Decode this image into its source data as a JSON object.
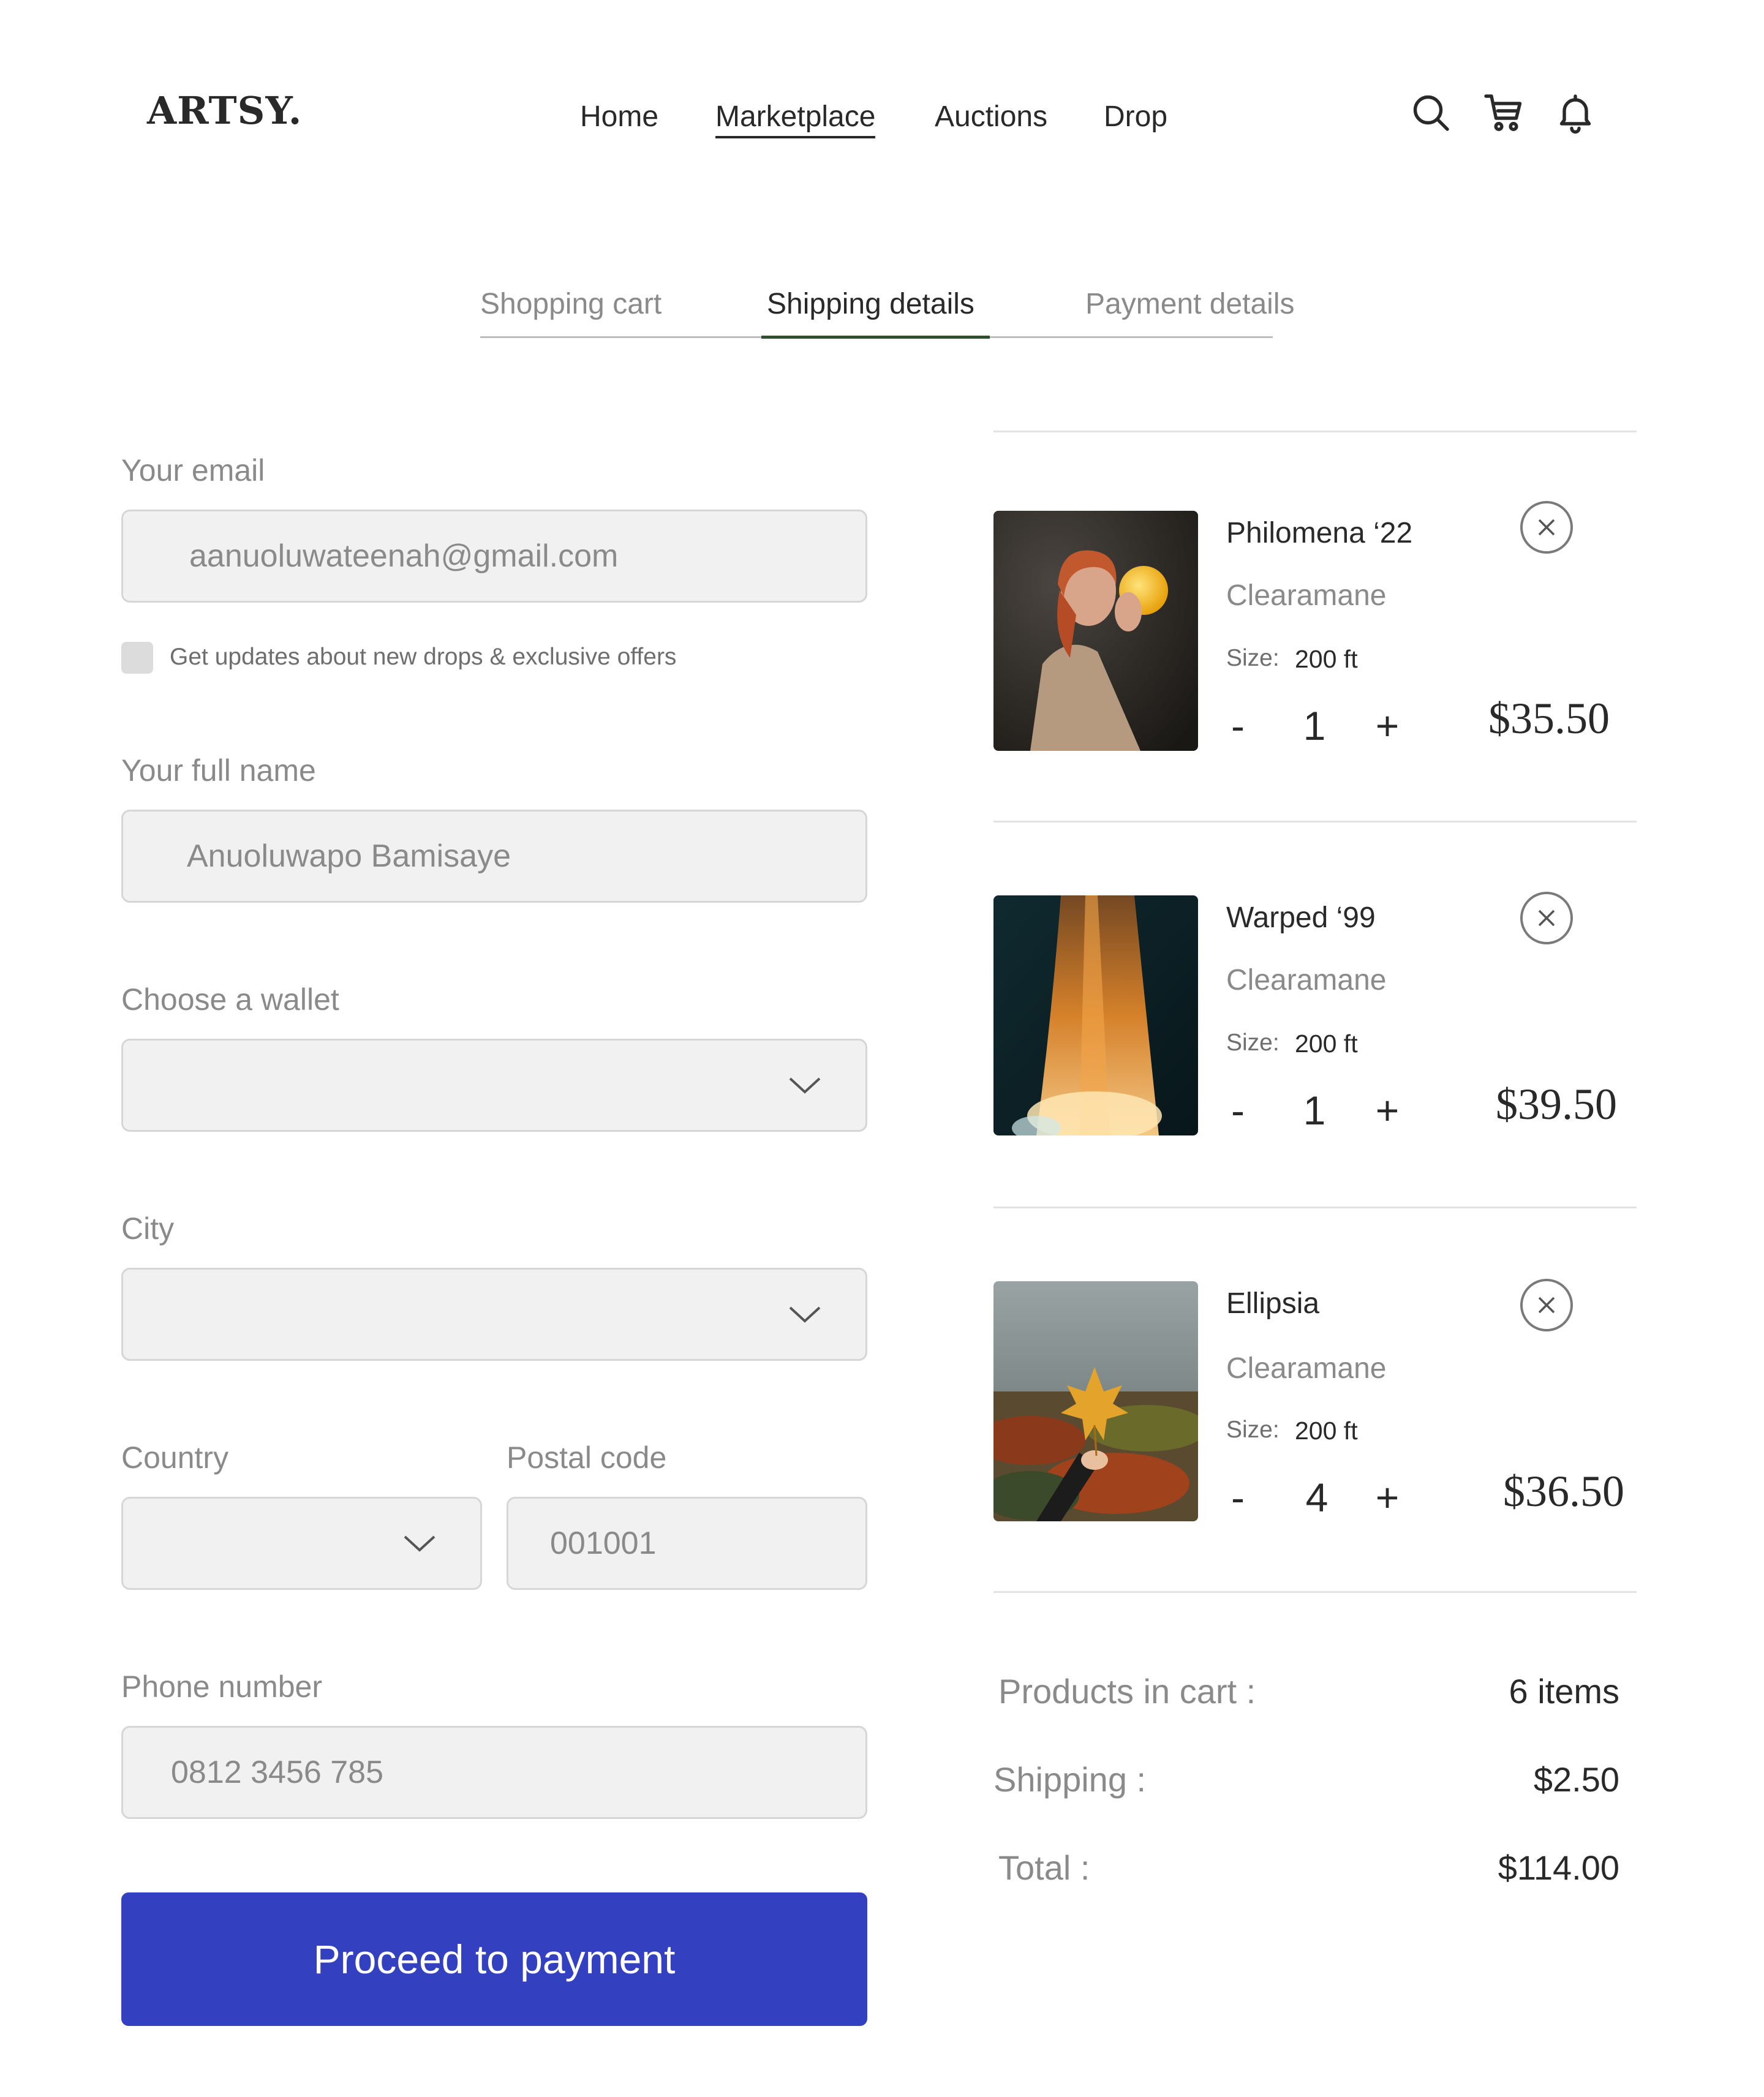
{
  "header": {
    "logo": "ARTSY.",
    "nav": [
      {
        "label": "Home",
        "active": false
      },
      {
        "label": "Marketplace",
        "active": true
      },
      {
        "label": "Auctions",
        "active": false
      },
      {
        "label": "Drop",
        "active": false
      }
    ],
    "icons": [
      "search-icon",
      "cart-icon",
      "bell-icon"
    ]
  },
  "steps": [
    {
      "label": "Shopping cart",
      "active": false
    },
    {
      "label": "Shipping details",
      "active": true
    },
    {
      "label": "Payment details",
      "active": false
    }
  ],
  "form": {
    "email": {
      "label": "Your email",
      "value": "aanuoluwateenah@gmail.com"
    },
    "updates_checkbox": {
      "label": "Get updates about new drops & exclusive offers",
      "checked": false
    },
    "full_name": {
      "label": "Your full name",
      "value": "Anuoluwapo Bamisaye"
    },
    "wallet": {
      "label": "Choose a wallet",
      "value": ""
    },
    "city": {
      "label": "City",
      "value": ""
    },
    "country": {
      "label": "Country",
      "value": ""
    },
    "postal_code": {
      "label": "Postal code",
      "value": "001001"
    },
    "phone": {
      "label": "Phone number",
      "value": "0812 3456 785"
    },
    "submit_label": "Proceed to payment"
  },
  "cart": {
    "size_label": "Size:",
    "decrement": "-",
    "increment": "+",
    "items": [
      {
        "name": "Philomena ‘22",
        "artist": "Clearamane",
        "size": "200 ft",
        "qty": "1",
        "price": "$35.50",
        "image": "woman-holding-glowing-orb"
      },
      {
        "name": "Warped ‘99",
        "artist": "Clearamane",
        "size": "200 ft",
        "qty": "1",
        "price": "$39.50",
        "image": "orange-fabric-flame"
      },
      {
        "name": "Ellipsia",
        "artist": "Clearamane",
        "size": "200 ft",
        "qty": "4",
        "price": "$36.50",
        "image": "hand-holding-maple-leaf"
      }
    ]
  },
  "summary": {
    "products": {
      "label": "Products in cart :",
      "value": "6 items"
    },
    "shipping": {
      "label": "Shipping :",
      "value": "$2.50"
    },
    "total": {
      "label": "Total :",
      "value": "$114.00"
    }
  },
  "colors": {
    "accent": "#3341c0",
    "text": "#292929",
    "muted": "#8a8a8a",
    "field_bg": "#f1f1f1",
    "active_step": "#2f4f2f"
  }
}
